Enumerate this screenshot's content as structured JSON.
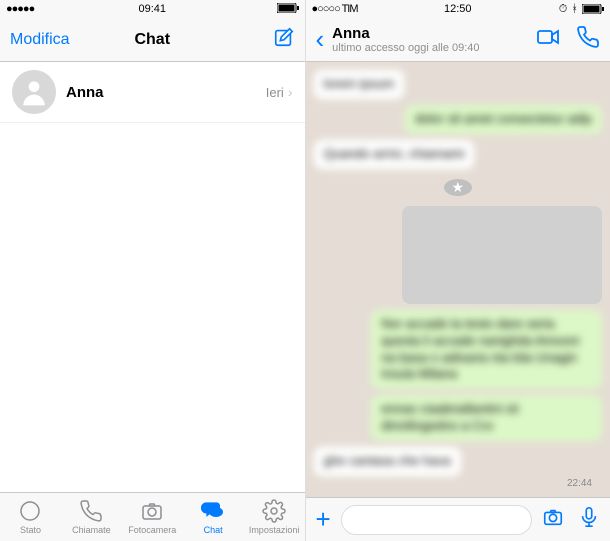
{
  "left": {
    "status": {
      "signal": "●●●●●",
      "time": "09:41",
      "battery": "■"
    },
    "header": {
      "edit": "Modifica",
      "title": "Chat"
    },
    "chat": {
      "name": "Anna",
      "time": "Ieri"
    },
    "tabs": {
      "status": "Stato",
      "calls": "Chiamate",
      "camera": "Fotocamera",
      "chat": "Chat",
      "settings": "Impostazioni"
    }
  },
  "right": {
    "status": {
      "carrier": "●○○○○ TIM",
      "time": "12:50"
    },
    "header": {
      "name": "Anna",
      "lastSeen": "ultimo accesso oggi alle 09:40"
    },
    "timestamp": "22:44",
    "messages": {
      "m1": "lorem ipsum",
      "m2": "dolor sit amet consectetur adip",
      "m3": "Quando arrivi, chiamami",
      "m4": "Nor accade la testo dare seria questa li accade nanighda Amooni na basa n adisaria nta kila Unagin insula Milana",
      "m5": "ennas ciaabnallaniini oii dinnilingedno a Cro",
      "m6": "ghe cantasa che hava"
    }
  }
}
